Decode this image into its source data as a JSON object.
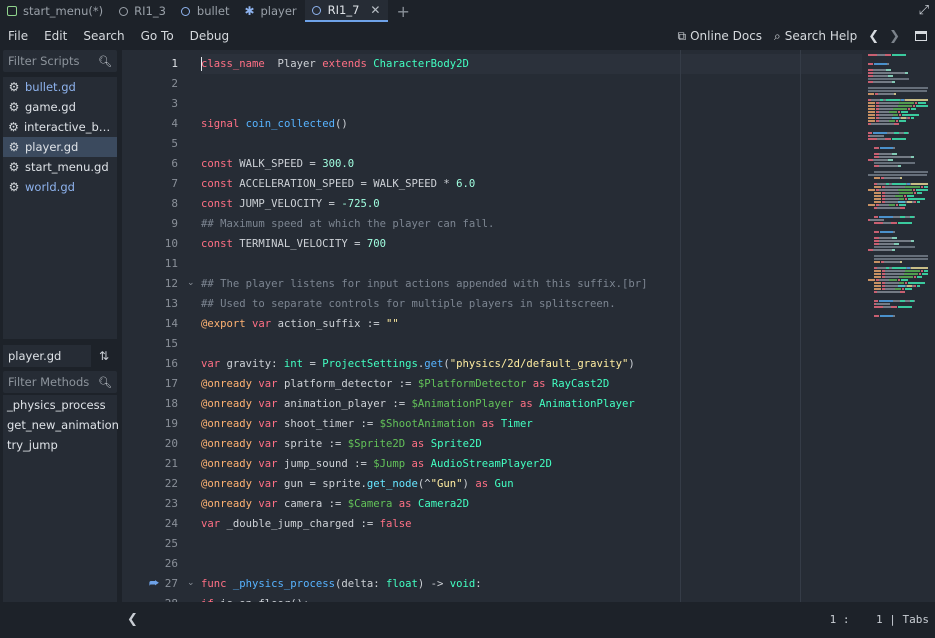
{
  "tabs": [
    {
      "label": "start_menu(*)",
      "icon": "scene-icon",
      "active": false
    },
    {
      "label": "RI1_3",
      "icon": "circle-icon",
      "active": false
    },
    {
      "label": "bullet",
      "icon": "circle-icon",
      "active": false
    },
    {
      "label": "player",
      "icon": "person-icon",
      "active": false
    },
    {
      "label": "RI1_7",
      "icon": "circle-icon",
      "active": true
    }
  ],
  "tab_close": "✕",
  "menu": {
    "items": [
      "File",
      "Edit",
      "Search",
      "Go To",
      "Debug"
    ],
    "online_docs": "Online Docs",
    "search_help": "Search Help"
  },
  "scripts": {
    "filter_placeholder": "Filter Scripts",
    "items": [
      {
        "label": "bullet.gd",
        "blue": true,
        "selected": false
      },
      {
        "label": "game.gd",
        "blue": false,
        "selected": false
      },
      {
        "label": "interactive_butt...",
        "blue": false,
        "selected": false
      },
      {
        "label": "player.gd",
        "blue": false,
        "selected": true
      },
      {
        "label": "start_menu.gd",
        "blue": false,
        "selected": false
      },
      {
        "label": "world.gd",
        "blue": true,
        "selected": false
      }
    ]
  },
  "current_file": "player.gd",
  "methods": {
    "filter_placeholder": "Filter Methods",
    "items": [
      "_physics_process",
      "get_new_animation",
      "try_jump"
    ]
  },
  "editor": {
    "lines": [
      {
        "n": "1",
        "tokens": [
          [
            "kw",
            "class_name"
          ],
          [
            "",
            "  Player "
          ],
          [
            "kw",
            "extends"
          ],
          [
            "",
            ""
          ],
          [
            "ty",
            " CharacterBody2D"
          ]
        ]
      },
      {
        "n": "2",
        "tokens": []
      },
      {
        "n": "3",
        "tokens": []
      },
      {
        "n": "4",
        "tokens": [
          [
            "kw",
            "signal"
          ],
          [
            "",
            " "
          ],
          [
            "fn",
            "coin_collected"
          ],
          [
            "",
            "()"
          ]
        ]
      },
      {
        "n": "5",
        "tokens": []
      },
      {
        "n": "6",
        "tokens": [
          [
            "kw",
            "const"
          ],
          [
            "",
            " WALK_SPEED = "
          ],
          [
            "nm",
            "300.0"
          ]
        ]
      },
      {
        "n": "7",
        "tokens": [
          [
            "kw",
            "const"
          ],
          [
            "",
            " ACCELERATION_SPEED = WALK_SPEED * "
          ],
          [
            "nm",
            "6.0"
          ]
        ]
      },
      {
        "n": "8",
        "tokens": [
          [
            "kw",
            "const"
          ],
          [
            "",
            " JUMP_VELOCITY = "
          ],
          [
            "nm",
            "-725.0"
          ]
        ]
      },
      {
        "n": "9",
        "tokens": [
          [
            "cm",
            "## Maximum speed at which the player can fall."
          ]
        ]
      },
      {
        "n": "10",
        "tokens": [
          [
            "kw",
            "const"
          ],
          [
            "",
            " TERMINAL_VELOCITY = "
          ],
          [
            "nm",
            "700"
          ]
        ]
      },
      {
        "n": "11",
        "tokens": []
      },
      {
        "n": "12",
        "tokens": [
          [
            "cm",
            "## The player listens for input actions appended with this suffix.[br]"
          ]
        ],
        "fold": true
      },
      {
        "n": "13",
        "tokens": [
          [
            "cm",
            "## Used to separate controls for multiple players in splitscreen."
          ]
        ]
      },
      {
        "n": "14",
        "tokens": [
          [
            "an",
            "@export"
          ],
          [
            "",
            " "
          ],
          [
            "kw",
            "var"
          ],
          [
            "",
            " action_suffix := "
          ],
          [
            "st",
            "\"\""
          ]
        ]
      },
      {
        "n": "15",
        "tokens": []
      },
      {
        "n": "16",
        "tokens": [
          [
            "kw",
            "var"
          ],
          [
            "",
            " gravity: "
          ],
          [
            "ty",
            "int"
          ],
          [
            "",
            " = "
          ],
          [
            "ty",
            "ProjectSettings"
          ],
          [
            "",
            "."
          ],
          [
            "fn",
            "get"
          ],
          [
            "",
            "("
          ],
          [
            "st",
            "\"physics/2d/default_gravity\""
          ],
          [
            "",
            ")"
          ]
        ]
      },
      {
        "n": "17",
        "tokens": [
          [
            "an",
            "@onready"
          ],
          [
            "",
            " "
          ],
          [
            "kw",
            "var"
          ],
          [
            "",
            " platform_detector := "
          ],
          [
            "np",
            "$PlatformDetector"
          ],
          [
            "",
            " "
          ],
          [
            "kw",
            "as"
          ],
          [
            "",
            " "
          ],
          [
            "ty",
            "RayCast2D"
          ]
        ]
      },
      {
        "n": "18",
        "tokens": [
          [
            "an",
            "@onready"
          ],
          [
            "",
            " "
          ],
          [
            "kw",
            "var"
          ],
          [
            "",
            " animation_player := "
          ],
          [
            "np",
            "$AnimationPlayer"
          ],
          [
            "",
            " "
          ],
          [
            "kw",
            "as"
          ],
          [
            "",
            " "
          ],
          [
            "ty",
            "AnimationPlayer"
          ]
        ]
      },
      {
        "n": "19",
        "tokens": [
          [
            "an",
            "@onready"
          ],
          [
            "",
            " "
          ],
          [
            "kw",
            "var"
          ],
          [
            "",
            " shoot_timer := "
          ],
          [
            "np",
            "$ShootAnimation"
          ],
          [
            "",
            " "
          ],
          [
            "kw",
            "as"
          ],
          [
            "",
            " "
          ],
          [
            "ty",
            "Timer"
          ]
        ]
      },
      {
        "n": "20",
        "tokens": [
          [
            "an",
            "@onready"
          ],
          [
            "",
            " "
          ],
          [
            "kw",
            "var"
          ],
          [
            "",
            " sprite := "
          ],
          [
            "np",
            "$Sprite2D"
          ],
          [
            "",
            " "
          ],
          [
            "kw",
            "as"
          ],
          [
            "",
            " "
          ],
          [
            "ty",
            "Sprite2D"
          ]
        ]
      },
      {
        "n": "21",
        "tokens": [
          [
            "an",
            "@onready"
          ],
          [
            "",
            " "
          ],
          [
            "kw",
            "var"
          ],
          [
            "",
            " jump_sound := "
          ],
          [
            "np",
            "$Jump"
          ],
          [
            "",
            " "
          ],
          [
            "kw",
            "as"
          ],
          [
            "",
            " "
          ],
          [
            "ty",
            "AudioStreamPlayer2D"
          ]
        ]
      },
      {
        "n": "22",
        "tokens": [
          [
            "an",
            "@onready"
          ],
          [
            "",
            " "
          ],
          [
            "kw",
            "var"
          ],
          [
            "",
            " gun = sprite."
          ],
          [
            "mt",
            "get_node"
          ],
          [
            "",
            "(^"
          ],
          [
            "st",
            "\"Gun\""
          ],
          [
            "",
            ") "
          ],
          [
            "kw",
            "as"
          ],
          [
            "",
            " "
          ],
          [
            "ty",
            "Gun"
          ]
        ]
      },
      {
        "n": "23",
        "tokens": [
          [
            "an",
            "@onready"
          ],
          [
            "",
            " "
          ],
          [
            "kw",
            "var"
          ],
          [
            "",
            " camera := "
          ],
          [
            "np",
            "$Camera"
          ],
          [
            "",
            " "
          ],
          [
            "kw",
            "as"
          ],
          [
            "",
            " "
          ],
          [
            "ty",
            "Camera2D"
          ]
        ]
      },
      {
        "n": "24",
        "tokens": [
          [
            "kw",
            "var"
          ],
          [
            "",
            " _double_jump_charged := "
          ],
          [
            "kw",
            "false"
          ]
        ]
      },
      {
        "n": "25",
        "tokens": []
      },
      {
        "n": "26",
        "tokens": []
      },
      {
        "n": "27",
        "tokens": [
          [
            "kw",
            "func"
          ],
          [
            "",
            " "
          ],
          [
            "fn",
            "_physics_process"
          ],
          [
            "",
            "(delta: "
          ],
          [
            "ty",
            "float"
          ],
          [
            "",
            ") -> "
          ],
          [
            "ty",
            "void"
          ],
          [
            "",
            ":"
          ]
        ],
        "fold": true,
        "override": true
      },
      {
        "n": "28",
        "tokens": [
          [
            "kw",
            "if"
          ],
          [
            "",
            " is_on_floor():"
          ]
        ]
      }
    ]
  },
  "status": {
    "line": "1",
    "col": "1",
    "indent": "Tabs"
  },
  "colors": {
    "accent": "#6ea2e8",
    "keyword": "#ff7085",
    "type": "#42ffc2",
    "function": "#57b3ff",
    "number": "#a1ffe0",
    "string": "#ffeda1",
    "comment": "#7c8591",
    "annotation": "#ffb373",
    "nodepath": "#63c259"
  }
}
